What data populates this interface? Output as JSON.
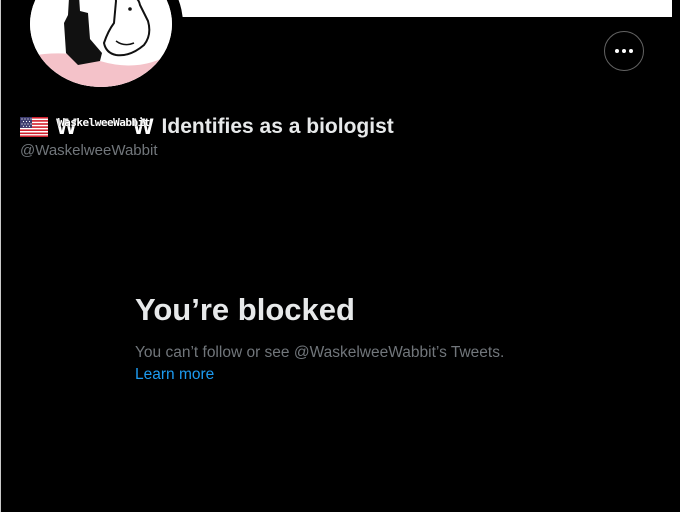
{
  "profile": {
    "display_name_overlay": "WaskelweeWabbit",
    "display_name_big_w1": "W",
    "display_name_big_w2": "W",
    "display_name_suffix": "Identifies as a biologist",
    "handle": "@WaskelweeWabbit",
    "flag_icon": "us-flag-icon",
    "avatar_icon": "bunny-avatar-icon"
  },
  "actions": {
    "more_icon": "more-horizontal-icon"
  },
  "blocked": {
    "title": "You’re blocked",
    "description": "You can’t follow or see @WaskelweeWabbit’s Tweets.",
    "learn_more": "Learn more"
  },
  "colors": {
    "background": "#000000",
    "primary_text": "#e7e9ea",
    "secondary_text": "#71767b",
    "link": "#1d9bf0",
    "avatar_pink": "#f4c2c9"
  }
}
